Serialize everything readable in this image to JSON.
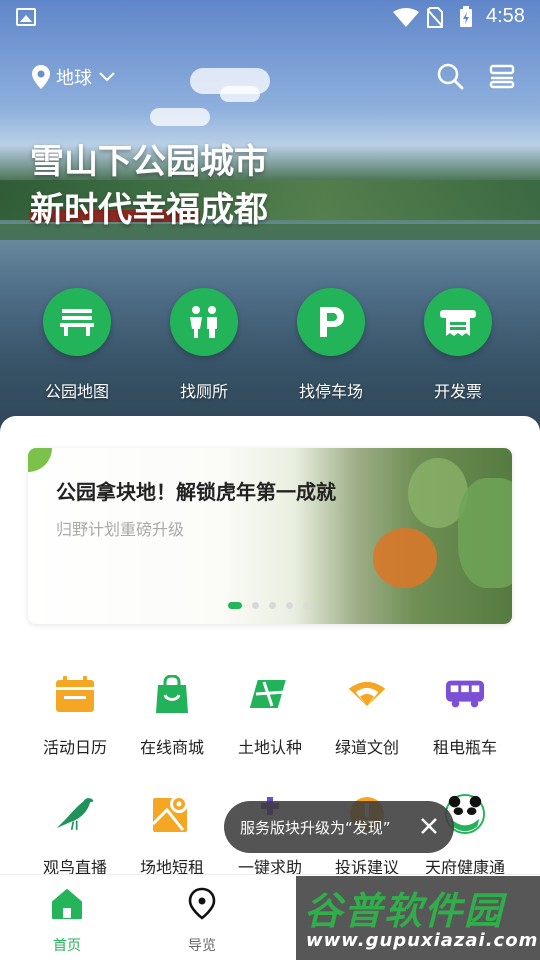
{
  "status_bar": {
    "time": "4:58",
    "icons": [
      "image-icon",
      "wifi-icon",
      "no-sim-icon",
      "battery-charging-icon"
    ]
  },
  "header": {
    "location_label": "地球",
    "icons": [
      "location-pin-icon",
      "chevron-down-icon",
      "search-icon",
      "menu-icon"
    ]
  },
  "hero": {
    "title_line1": "雪山下公园城市",
    "title_line2": "新时代幸福成都"
  },
  "quick_actions": [
    {
      "label": "公园地图",
      "icon": "bench-icon"
    },
    {
      "label": "找厕所",
      "icon": "restroom-icon"
    },
    {
      "label": "找停车场",
      "icon": "parking-icon"
    },
    {
      "label": "开发票",
      "icon": "invoice-printer-icon"
    }
  ],
  "banner": {
    "title": "公园拿块地！解锁虎年第一成就",
    "subtitle": "归野计划重磅升级",
    "page_count": 5,
    "active_page": 0
  },
  "services_row1": [
    {
      "label": "活动日历",
      "icon": "calendar-icon",
      "color": "#F5A623"
    },
    {
      "label": "在线商城",
      "icon": "shopping-bag-icon",
      "color": "#22B25A"
    },
    {
      "label": "土地认种",
      "icon": "land-plot-icon",
      "color": "#22B25A"
    },
    {
      "label": "绿道文创",
      "icon": "fan-icon",
      "color": "#F5A623"
    },
    {
      "label": "租电瓶车",
      "icon": "bus-icon",
      "color": "#7B4FD6"
    }
  ],
  "services_row2": [
    {
      "label": "观鸟直播",
      "icon": "bird-icon",
      "color": "#22915A"
    },
    {
      "label": "场地短租",
      "icon": "map-pin-icon",
      "color": "#F5A623"
    },
    {
      "label": "一键求助",
      "icon": "help-plus-icon",
      "color": "#6D4BD6"
    },
    {
      "label": "投诉建议",
      "icon": "alert-icon",
      "color": "#F5A623"
    },
    {
      "label": "天府健康通",
      "icon": "panda-icon",
      "color": "#22B25A"
    }
  ],
  "toast": {
    "text": "服务版块升级为“发现”"
  },
  "tabs": [
    {
      "label": "首页",
      "icon": "home-icon",
      "active": true
    },
    {
      "label": "导览",
      "icon": "location-icon",
      "active": false
    }
  ],
  "watermark": {
    "title": "谷普软件园",
    "url": "www.gupuxiazai.com"
  },
  "colors": {
    "primary_green": "#24B45A",
    "text_dark": "#222222",
    "toast_bg": "#3C3C3C"
  }
}
